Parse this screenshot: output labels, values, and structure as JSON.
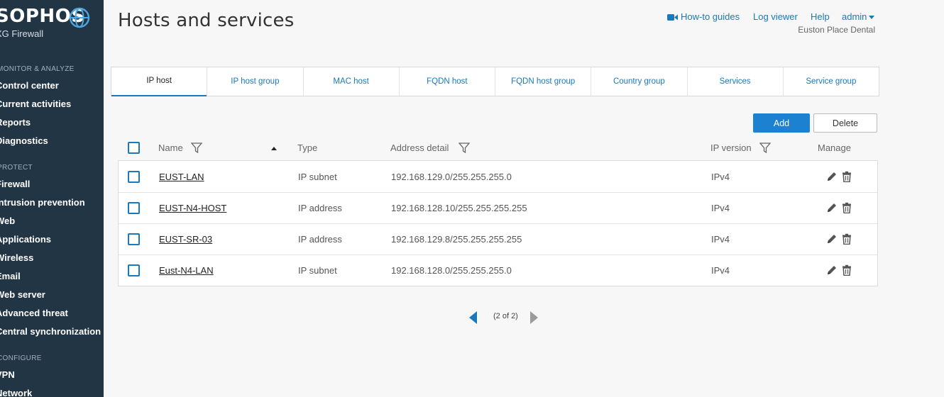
{
  "app": {
    "brand": "SOPHOS",
    "product": "XG Firewall"
  },
  "sidebar": {
    "sections": [
      {
        "label": "MONITOR & ANALYZE",
        "items": [
          "Control center",
          "Current activities",
          "Reports",
          "Diagnostics"
        ]
      },
      {
        "label": "PROTECT",
        "items": [
          "Firewall",
          "Intrusion prevention",
          "Web",
          "Applications",
          "Wireless",
          "Email",
          "Web server",
          "Advanced threat",
          "Central synchronization"
        ]
      },
      {
        "label": "CONFIGURE",
        "items": [
          "VPN",
          "Network"
        ]
      }
    ]
  },
  "header": {
    "title": "Hosts and services",
    "links": {
      "howto": "How-to guides",
      "logviewer": "Log viewer",
      "help": "Help",
      "admin": "admin"
    },
    "org": "Euston Place Dental"
  },
  "tabs": [
    "IP host",
    "IP host group",
    "MAC host",
    "FQDN host",
    "FQDN host group",
    "Country group",
    "Services",
    "Service group"
  ],
  "active_tab": "IP host",
  "toolbar": {
    "add": "Add",
    "delete": "Delete"
  },
  "table": {
    "columns": {
      "name": "Name",
      "type": "Type",
      "address": "Address detail",
      "version": "IP version",
      "manage": "Manage"
    },
    "rows": [
      {
        "name": "EUST-LAN",
        "type": "IP subnet",
        "address": "192.168.129.0/255.255.255.0",
        "version": "IPv4"
      },
      {
        "name": "EUST-N4-HOST",
        "type": "IP address",
        "address": "192.168.128.10/255.255.255.255",
        "version": "IPv4"
      },
      {
        "name": "EUST-SR-03",
        "type": "IP address",
        "address": "192.168.129.8/255.255.255.255",
        "version": "IPv4"
      },
      {
        "name": "Eust-N4-LAN",
        "type": "IP subnet",
        "address": "192.168.128.0/255.255.255.0",
        "version": "IPv4"
      }
    ]
  },
  "pagination": {
    "text": "(2 of 2)"
  },
  "colors": {
    "accent": "#1b78b9",
    "sidebar": "#223544",
    "button": "#1b81d0"
  }
}
